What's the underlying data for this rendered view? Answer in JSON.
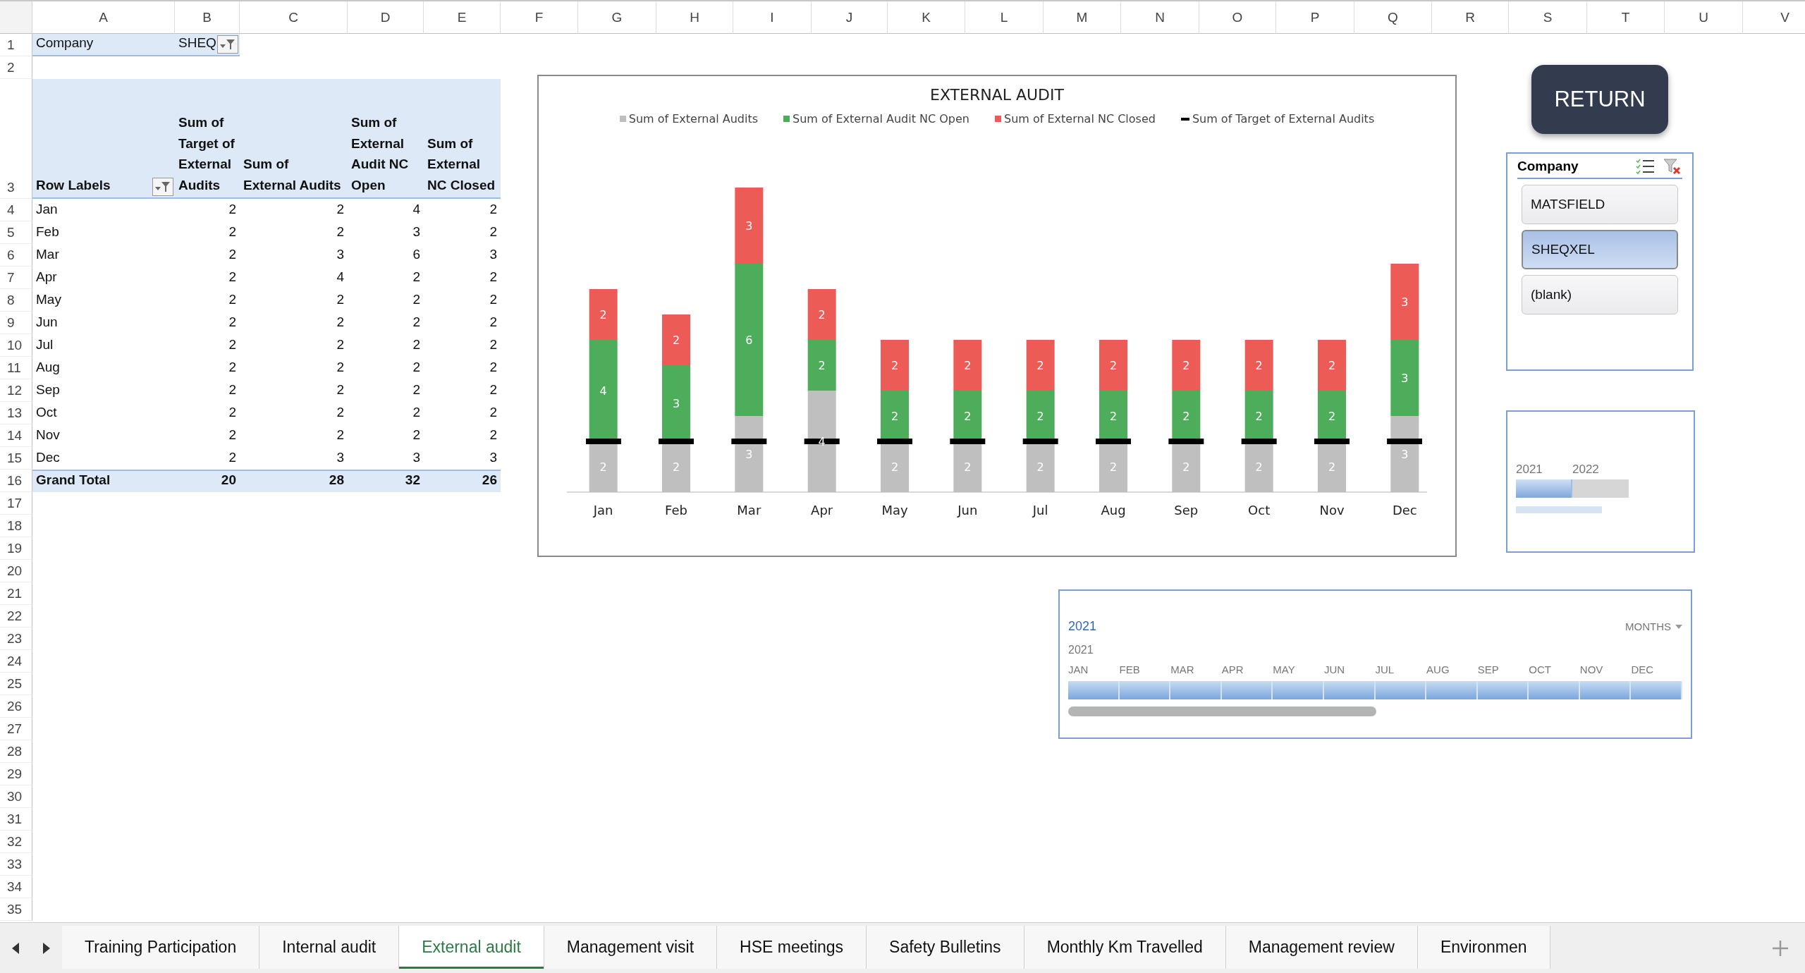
{
  "sheet": {
    "columns": [
      "A",
      "B",
      "C",
      "D",
      "E",
      "F",
      "G",
      "H",
      "I",
      "J",
      "K",
      "L",
      "M",
      "N",
      "O",
      "P",
      "Q",
      "R",
      "S",
      "T",
      "U",
      "V"
    ],
    "rows": [
      "1",
      "2",
      "3",
      "4",
      "5",
      "6",
      "7",
      "8",
      "9",
      "10",
      "11",
      "12",
      "13",
      "14",
      "15",
      "16",
      "17",
      "18",
      "19",
      "20",
      "21",
      "22",
      "23",
      "24",
      "25",
      "26",
      "27",
      "28",
      "29",
      "30",
      "31",
      "32",
      "33",
      "34",
      "35"
    ]
  },
  "pivot": {
    "filter": {
      "label": "Company",
      "value": "SHEQ"
    },
    "row_labels_header": "Row Labels",
    "columns": [
      "Sum of Target of External Audits",
      "Sum of External Audits",
      "Sum of External Audit NC Open",
      "Sum of External NC Closed"
    ],
    "rows": [
      {
        "label": "Jan",
        "values": [
          "2",
          "2",
          "4",
          "2"
        ]
      },
      {
        "label": "Feb",
        "values": [
          "2",
          "2",
          "3",
          "2"
        ]
      },
      {
        "label": "Mar",
        "values": [
          "2",
          "3",
          "6",
          "3"
        ]
      },
      {
        "label": "Apr",
        "values": [
          "2",
          "4",
          "2",
          "2"
        ]
      },
      {
        "label": "May",
        "values": [
          "2",
          "2",
          "2",
          "2"
        ]
      },
      {
        "label": "Jun",
        "values": [
          "2",
          "2",
          "2",
          "2"
        ]
      },
      {
        "label": "Jul",
        "values": [
          "2",
          "2",
          "2",
          "2"
        ]
      },
      {
        "label": "Aug",
        "values": [
          "2",
          "2",
          "2",
          "2"
        ]
      },
      {
        "label": "Sep",
        "values": [
          "2",
          "2",
          "2",
          "2"
        ]
      },
      {
        "label": "Oct",
        "values": [
          "2",
          "2",
          "2",
          "2"
        ]
      },
      {
        "label": "Nov",
        "values": [
          "2",
          "2",
          "2",
          "2"
        ]
      },
      {
        "label": "Dec",
        "values": [
          "2",
          "3",
          "3",
          "3"
        ]
      }
    ],
    "total": {
      "label": "Grand Total",
      "values": [
        "20",
        "28",
        "32",
        "26"
      ]
    }
  },
  "chart": {
    "chart_data": {
      "type": "bar",
      "title": "EXTERNAL AUDIT",
      "stacked": true,
      "legend": "top",
      "data_labels": true,
      "categories": [
        "Jan",
        "Feb",
        "Mar",
        "Apr",
        "May",
        "Jun",
        "Jul",
        "Aug",
        "Sep",
        "Oct",
        "Nov",
        "Dec"
      ],
      "series": [
        {
          "name": "Sum of External Audits",
          "color": "#bfbfbf",
          "values": [
            2,
            2,
            3,
            4,
            2,
            2,
            2,
            2,
            2,
            2,
            2,
            3
          ]
        },
        {
          "name": "Sum of External Audit NC Open",
          "color": "#4ead5b",
          "values": [
            4,
            3,
            6,
            2,
            2,
            2,
            2,
            2,
            2,
            2,
            2,
            3
          ]
        },
        {
          "name": "Sum of External NC Closed",
          "color": "#ec5b56",
          "values": [
            2,
            2,
            3,
            2,
            2,
            2,
            2,
            2,
            2,
            2,
            2,
            3
          ]
        },
        {
          "name": "Sum of Target of External Audits",
          "color": "#000000",
          "type": "line",
          "line_style": "dashed",
          "value_labels": [
            null,
            null,
            null,
            null,
            null,
            null,
            null,
            null,
            null,
            null,
            null,
            null
          ],
          "values": [
            2,
            2,
            2,
            2,
            2,
            2,
            2,
            2,
            2,
            2,
            2,
            2
          ]
        }
      ]
    }
  },
  "return_button": "RETURN",
  "slicer": {
    "title": "Company",
    "items": [
      {
        "label": "MATSFIELD",
        "selected": false
      },
      {
        "label": "SHEQXEL",
        "selected": true
      },
      {
        "label": "(blank)",
        "selected": false
      }
    ]
  },
  "year_timeline": {
    "years": [
      {
        "label": "2021",
        "selected": true
      },
      {
        "label": "2022",
        "selected": false
      }
    ]
  },
  "timeline": {
    "header": "2021",
    "level": "MONTHS",
    "year": "2021",
    "months": [
      {
        "label": "JAN",
        "selected": true
      },
      {
        "label": "FEB",
        "selected": true
      },
      {
        "label": "MAR",
        "selected": true
      },
      {
        "label": "APR",
        "selected": true
      },
      {
        "label": "MAY",
        "selected": true
      },
      {
        "label": "JUN",
        "selected": true
      },
      {
        "label": "JUL",
        "selected": true
      },
      {
        "label": "AUG",
        "selected": true
      },
      {
        "label": "SEP",
        "selected": true
      },
      {
        "label": "OCT",
        "selected": true
      },
      {
        "label": "NOV",
        "selected": true
      },
      {
        "label": "DEC",
        "selected": true
      }
    ]
  },
  "sheet_tabs": [
    {
      "label": "Training Participation",
      "selected": false
    },
    {
      "label": "Internal audit",
      "selected": false
    },
    {
      "label": "External audit",
      "selected": true
    },
    {
      "label": "Management visit",
      "selected": false
    },
    {
      "label": "HSE meetings",
      "selected": false
    },
    {
      "label": "Safety Bulletins",
      "selected": false
    },
    {
      "label": "Monthly Km Travelled",
      "selected": false
    },
    {
      "label": "Management review",
      "selected": false
    },
    {
      "label": "Environmen",
      "selected": false
    }
  ]
}
